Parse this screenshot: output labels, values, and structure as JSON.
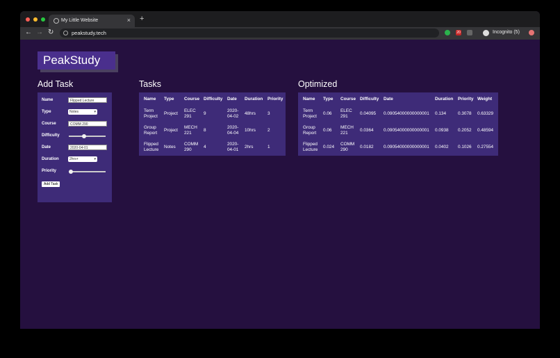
{
  "browser": {
    "tab_title": "My Little Website",
    "tab_close": "×",
    "new_tab": "+",
    "url": "peakstudy.tech",
    "back": "←",
    "forward": "→",
    "reload": "↻",
    "incognito_label": "Incognito (5)",
    "ext_badge": "20"
  },
  "page": {
    "brand": "PeakStudy",
    "add_task": {
      "heading": "Add Task",
      "name_label": "Name",
      "name_value": "Flipped Lecture",
      "type_label": "Type",
      "type_value": "Notes",
      "course_label": "Course",
      "course_value": "COMM 290",
      "difficulty_label": "Difficulty",
      "difficulty_level": 0.4,
      "date_label": "Date",
      "date_value": "2020-04-01",
      "duration_label": "Duration",
      "duration_value": "2hrs+",
      "priority_label": "Priority",
      "priority_level": 0.0,
      "submit_label": "Add Task"
    },
    "tasks": {
      "heading": "Tasks",
      "columns": [
        "Name",
        "Type",
        "Course",
        "Difficulty",
        "Date",
        "Duration",
        "Priority"
      ],
      "rows": [
        [
          "Term Project",
          "Project",
          "ELEC 291",
          "9",
          "2020-04-02",
          "48hrs",
          "3"
        ],
        [
          "Group Report",
          "Project",
          "MECH 221",
          "8",
          "2020-04-04",
          "10hrs",
          "2"
        ],
        [
          "Flipped Lecture",
          "Notes",
          "COMM 290",
          "4",
          "2020-04-01",
          "2hrs",
          "1"
        ]
      ]
    },
    "optimized": {
      "heading": "Optimized",
      "columns": [
        "Name",
        "Type",
        "Course",
        "Difficulty",
        "Date",
        "Duration",
        "Priority",
        "Weight"
      ],
      "rows": [
        [
          "Term Project",
          "0.06",
          "ELEC 291",
          "0.04095",
          "0.09054000000000001",
          "0.134",
          "0.3078",
          "0.63329"
        ],
        [
          "Group Report",
          "0.06",
          "MECH 221",
          "0.0364",
          "0.09054000000000001",
          "0.0938",
          "0.2052",
          "0.48594"
        ],
        [
          "Flipped Lecture",
          "0.024",
          "COMM 290",
          "0.0182",
          "0.09054000000000001",
          "0.0402",
          "0.1026",
          "0.27554"
        ]
      ]
    }
  }
}
